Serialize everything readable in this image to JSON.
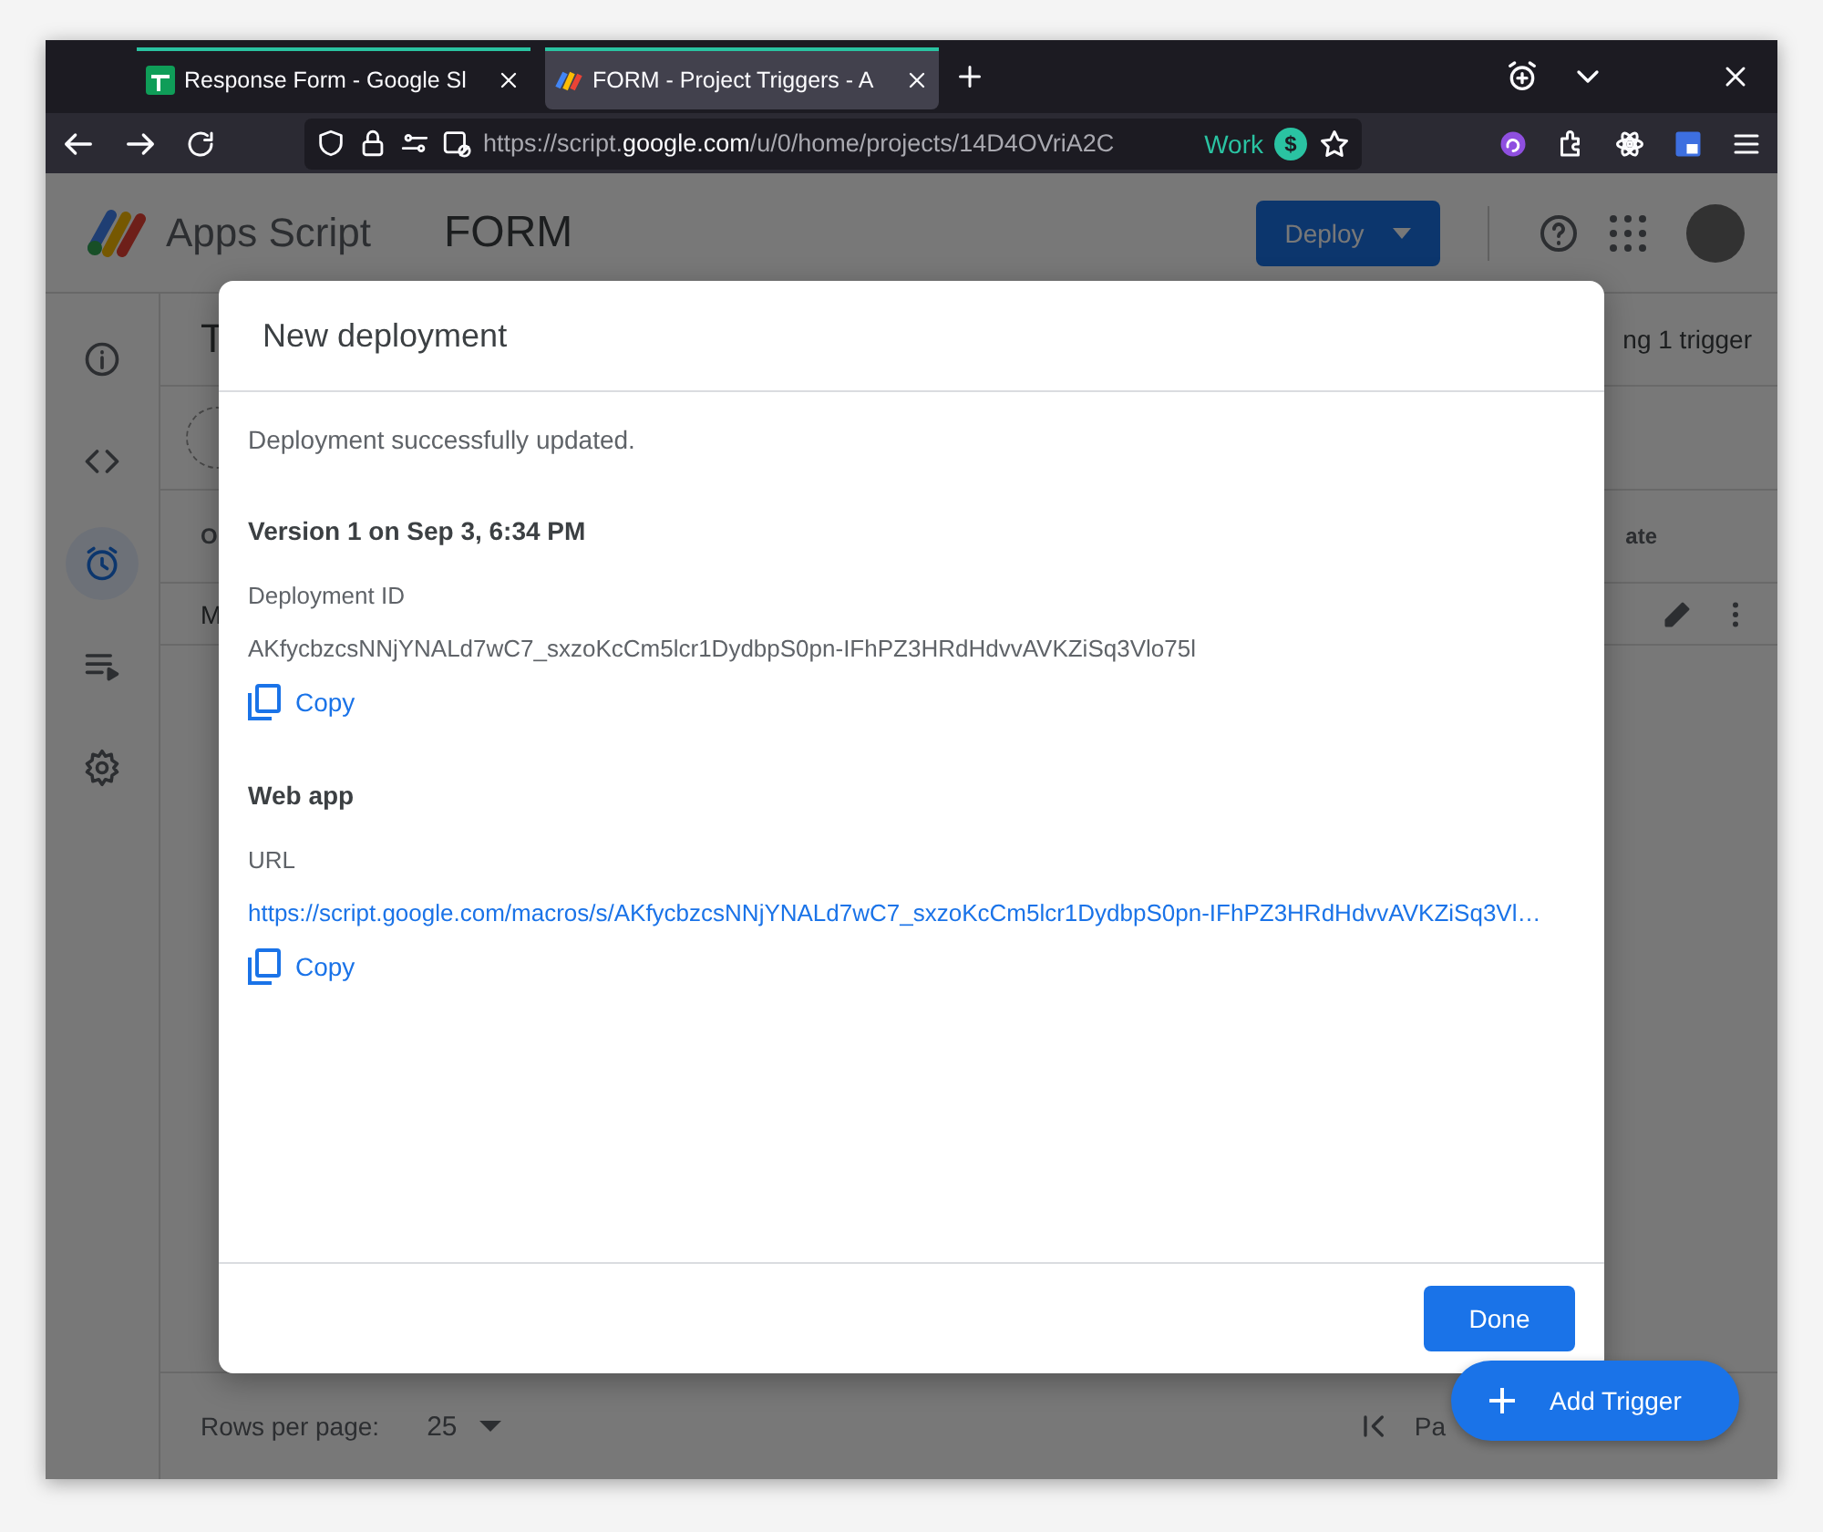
{
  "browser": {
    "tabs": [
      {
        "title": "Response Form - Google Sl",
        "selected": false
      },
      {
        "title": "FORM - Project Triggers - A",
        "selected": true
      }
    ],
    "address": "https://script.**google.com**/u/0/home/projects/14D4OVriA2C",
    "container": "Work",
    "container_badge": "$"
  },
  "app": {
    "name": "Apps Script",
    "project": "FORM",
    "deploy": "Deploy"
  },
  "sidebar": [
    {
      "selected": false
    },
    {
      "selected": false
    },
    {
      "selected": true
    },
    {
      "selected": false
    },
    {
      "selected": false
    }
  ],
  "main": {
    "title": "T",
    "trigger_count": "ng 1 trigger",
    "table": {
      "column_1": "O",
      "column_last": "ate",
      "row_cell": "M"
    },
    "pagination": {
      "label": "Rows per page:",
      "value": "25",
      "page": "Pa"
    }
  },
  "dialog": {
    "title": "New deployment",
    "message": "Deployment successfully updated.",
    "sections": [
      {
        "heading": "Version 1 on Sep 3, 6:34 PM",
        "label": "Deployment ID",
        "kind": "text",
        "value": "AKfycbzcsNNjYNALd7wC7_sxzoKcCm5lcr1DydbpS0pn-IFhPZ3HRdHdvvAVKZiSq3Vlo75l",
        "copy": "Copy"
      },
      {
        "heading": "Web app",
        "label": "URL",
        "kind": "link",
        "value": "https://script.google.com/macros/s/AKfycbzcsNNjYNALd7wC7_sxzoKcCm5lcr1DydbpS0pn-IFhPZ3HRdHdvvAVKZiSq3Vl…",
        "copy": "Copy"
      }
    ],
    "done": "Done"
  },
  "fab": {
    "label": "Add Trigger"
  }
}
